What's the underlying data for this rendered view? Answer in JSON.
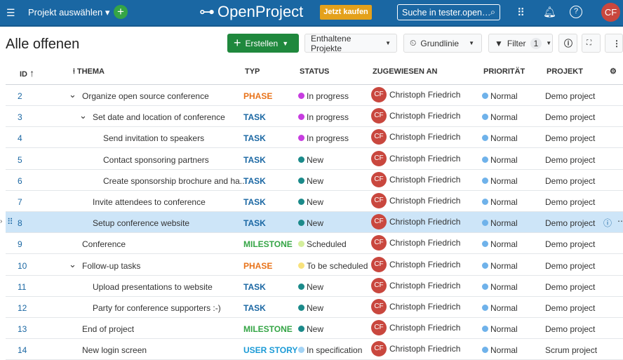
{
  "header": {
    "project_select": "Projekt auswählen",
    "logo": "OpenProject",
    "buy": "Jetzt kaufen",
    "search_placeholder": "Suche in tester.open…",
    "avatar": "CF"
  },
  "toolbar": {
    "title": "Alle offenen",
    "create": "Erstellen",
    "included_projects": "Enthaltene Projekte",
    "baseline": "Grundlinie",
    "filter": "Filter",
    "filter_count": "1"
  },
  "columns": [
    "ID",
    "THEMA",
    "TYP",
    "STATUS",
    "ZUGEWIESEN AN",
    "PRIORITÄT",
    "PROJEKT"
  ],
  "colors": {
    "phase": "#e8731a",
    "task": "#1a67a3",
    "milestone": "#35a546",
    "user_story": "#1a9ad6",
    "in_progress": "#c73de0",
    "new": "#1b8a8a",
    "scheduled": "#d4ee9c",
    "to_be_scheduled": "#f8e27c",
    "in_specification": "#a3d3f5",
    "normal": "#6fb2ea"
  },
  "rows": [
    {
      "id": "2",
      "subject": "Organize open source conference",
      "level": 0,
      "expand": true,
      "type": "PHASE",
      "tcol": "phase",
      "status": "In progress",
      "scol": "in_progress",
      "assignee": "Christoph Friedrich",
      "initials": "CF",
      "priority": "Normal",
      "project": "Demo project"
    },
    {
      "id": "3",
      "subject": "Set date and location of conference",
      "level": 1,
      "expand": true,
      "type": "TASK",
      "tcol": "task",
      "status": "In progress",
      "scol": "in_progress",
      "assignee": "Christoph Friedrich",
      "initials": "CF",
      "priority": "Normal",
      "project": "Demo project"
    },
    {
      "id": "4",
      "subject": "Send invitation to speakers",
      "level": 2,
      "type": "TASK",
      "tcol": "task",
      "status": "In progress",
      "scol": "in_progress",
      "assignee": "Christoph Friedrich",
      "initials": "CF",
      "priority": "Normal",
      "project": "Demo project"
    },
    {
      "id": "5",
      "subject": "Contact sponsoring partners",
      "level": 2,
      "type": "TASK",
      "tcol": "task",
      "status": "New",
      "scol": "new",
      "assignee": "Christoph Friedrich",
      "initials": "CF",
      "priority": "Normal",
      "project": "Demo project"
    },
    {
      "id": "6",
      "subject": "Create sponsorship brochure and ha...",
      "level": 2,
      "type": "TASK",
      "tcol": "task",
      "status": "New",
      "scol": "new",
      "assignee": "Christoph Friedrich",
      "initials": "CF",
      "priority": "Normal",
      "project": "Demo project"
    },
    {
      "id": "7",
      "subject": "Invite attendees to conference",
      "level": 1,
      "type": "TASK",
      "tcol": "task",
      "status": "New",
      "scol": "new",
      "assignee": "Christoph Friedrich",
      "initials": "CF",
      "priority": "Normal",
      "project": "Demo project"
    },
    {
      "id": "8",
      "subject": "Setup conference website",
      "level": 1,
      "type": "TASK",
      "tcol": "task",
      "status": "New",
      "scol": "new",
      "assignee": "Christoph Friedrich",
      "initials": "CF",
      "priority": "Normal",
      "project": "Demo project",
      "selected": true
    },
    {
      "id": "9",
      "subject": "Conference",
      "level": 0,
      "type": "MILESTONE",
      "tcol": "milestone",
      "status": "Scheduled",
      "scol": "scheduled",
      "assignee": "Christoph Friedrich",
      "initials": "CF",
      "priority": "Normal",
      "project": "Demo project"
    },
    {
      "id": "10",
      "subject": "Follow-up tasks",
      "level": 0,
      "expand": true,
      "type": "PHASE",
      "tcol": "phase",
      "status": "To be scheduled",
      "scol": "to_be_scheduled",
      "assignee": "Christoph Friedrich",
      "initials": "CF",
      "priority": "Normal",
      "project": "Demo project"
    },
    {
      "id": "11",
      "subject": "Upload presentations to website",
      "level": 1,
      "type": "TASK",
      "tcol": "task",
      "status": "New",
      "scol": "new",
      "assignee": "Christoph Friedrich",
      "initials": "CF",
      "priority": "Normal",
      "project": "Demo project"
    },
    {
      "id": "12",
      "subject": "Party for conference supporters :-)",
      "level": 1,
      "type": "TASK",
      "tcol": "task",
      "status": "New",
      "scol": "new",
      "assignee": "Christoph Friedrich",
      "initials": "CF",
      "priority": "Normal",
      "project": "Demo project"
    },
    {
      "id": "13",
      "subject": "End of project",
      "level": 0,
      "type": "MILESTONE",
      "tcol": "milestone",
      "status": "New",
      "scol": "new",
      "assignee": "Christoph Friedrich",
      "initials": "CF",
      "priority": "Normal",
      "project": "Demo project"
    },
    {
      "id": "14",
      "subject": "New login screen",
      "level": 0,
      "type": "USER STORY",
      "tcol": "user_story",
      "status": "In specification",
      "scol": "in_specification",
      "assignee": "Christoph Friedrich",
      "initials": "CF",
      "priority": "Normal",
      "project": "Scrum project"
    }
  ]
}
